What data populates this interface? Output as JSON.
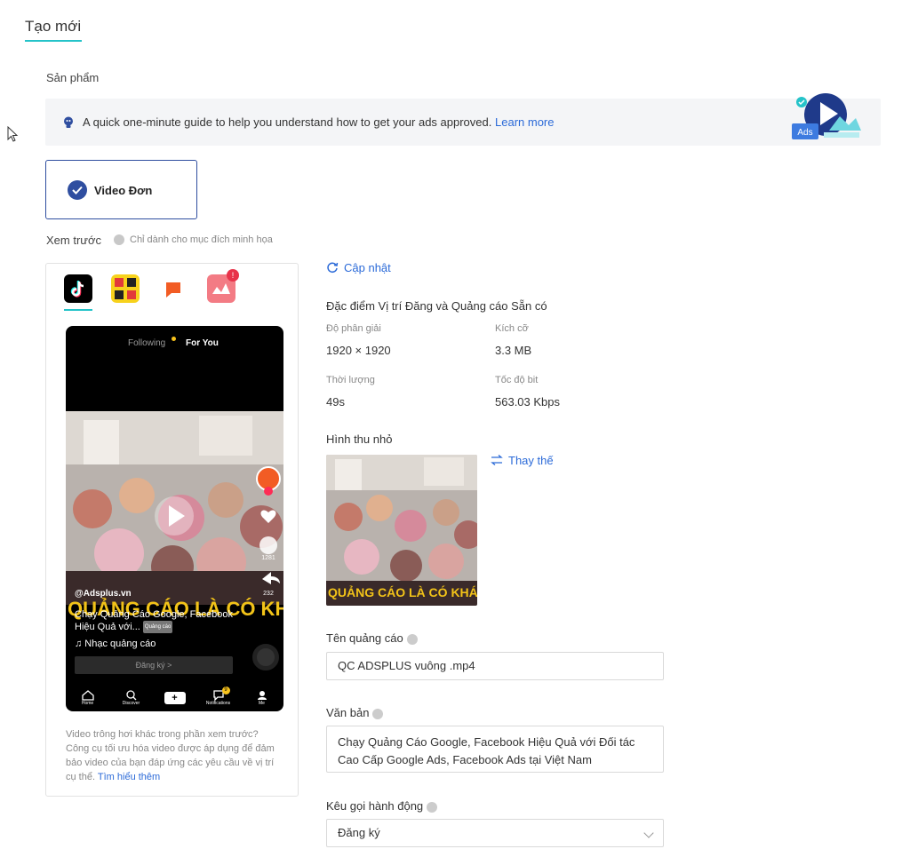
{
  "page": {
    "title": "Tạo mới",
    "section_label": "Sản phẩm"
  },
  "guide": {
    "text": "A quick one-minute guide to help you understand how to get your ads approved.",
    "link": "Learn more",
    "art_badge": "Ads"
  },
  "format_card": {
    "label": "Video Đơn",
    "selected": true
  },
  "preview": {
    "label": "Xem trước",
    "hint": "Chỉ dành cho mục đích minh họa",
    "app_tabs": [
      "tiktok-icon",
      "pangle-icon",
      "buzzvideo-icon",
      "babe-icon"
    ],
    "phone": {
      "following": "Following",
      "for_you": "For You",
      "handle": "@Adsplus.vn",
      "overlay_text": "QUẢNG CÁO LÀ CÓ KHÁCH",
      "caption": "Chạy Quảng Cáo Google, Facebook Hiệu Quả với...",
      "caption_tag": "Quảng cáo",
      "music": "♫ Nhạc quảng cáo",
      "cta": "Đăng ký >",
      "like_count": "1281",
      "share_count": "232",
      "nav": [
        "Home",
        "Discover",
        "",
        "Notifications",
        "Me"
      ],
      "notification_badge": "9"
    },
    "note": "Video trông hơi khác trong phần xem trước? Công cụ tối ưu hóa video được áp dụng để đảm bảo video của bạn đáp ứng các yêu cầu về vị trí cụ thể.",
    "note_link": "Tìm hiểu thêm"
  },
  "details": {
    "refresh": "Cập nhật",
    "specs_title": "Đặc điểm Vị trí Đăng và Quảng cáo Sẵn có",
    "resolution_label": "Độ phân giải",
    "resolution_value": "1920 × 1920",
    "size_label": "Kích cỡ",
    "size_value": "3.3 MB",
    "duration_label": "Thời lượng",
    "duration_value": "49s",
    "bitrate_label": "Tốc độ bit",
    "bitrate_value": "563.03 Kbps",
    "thumbnail_label": "Hình thu nhỏ",
    "replace": "Thay thế"
  },
  "form": {
    "ad_name_label": "Tên quảng cáo",
    "ad_name_value": "QC ADSPLUS vuông .mp4",
    "text_label": "Văn bản",
    "text_value": "Chạy Quảng Cáo Google, Facebook Hiệu Quả với Đối tác Cao Cấp Google Ads,  Facebook Ads tại Việt Nam",
    "cta_label": "Kêu gọi hành động",
    "cta_value": "Đăng ký"
  },
  "colors": {
    "accent_teal": "#25c3c9",
    "primary_blue": "#2f4ea0",
    "link_blue": "#2b6ad8"
  }
}
